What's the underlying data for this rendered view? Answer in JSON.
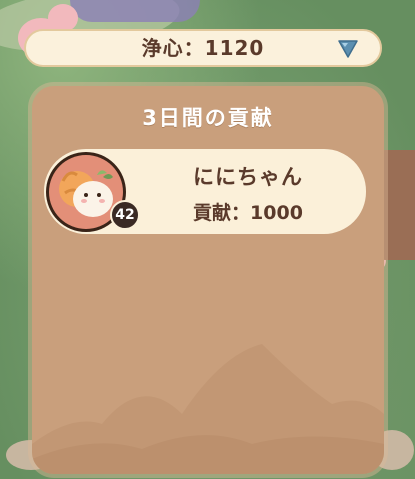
{
  "currency": {
    "label": "浄心：1120",
    "icon": "blue-gem-icon",
    "icon_color": "#5c8fb0"
  },
  "panel": {
    "title": "3日間の貢献",
    "entries": [
      {
        "name": "ににちゃん",
        "contribution_label": "貢献：1000",
        "level": "42",
        "avatar": "cat-avatar-icon"
      }
    ]
  },
  "colors": {
    "panel": "#c99f7c",
    "entry": "#fbf0d9",
    "text": "#5a3a2b",
    "avatar_bg": "#e38f78"
  }
}
